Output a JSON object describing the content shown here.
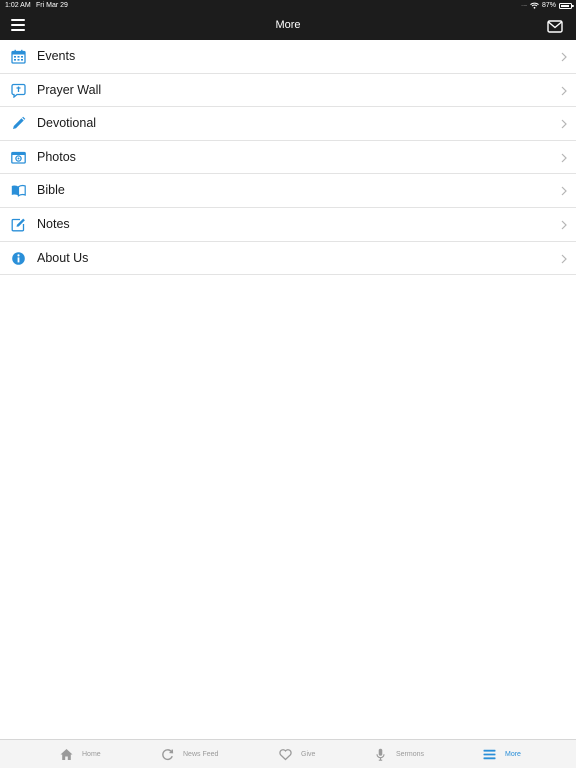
{
  "status_bar": {
    "time": "1:02 AM",
    "date": "Fri Mar 29",
    "signal": ".....",
    "battery_percent_label": "87%",
    "battery_level": 0.87
  },
  "nav": {
    "title": "More",
    "menu_icon": "hamburger-icon",
    "mail_icon": "envelope-icon"
  },
  "colors": {
    "accent": "#2a8fd8",
    "navbar": "#1c1c1c",
    "tab_inactive": "#9a9a9a"
  },
  "menu": {
    "items": [
      {
        "label": "Events",
        "icon": "calendar-icon"
      },
      {
        "label": "Prayer Wall",
        "icon": "prayer-bubble-icon"
      },
      {
        "label": "Devotional",
        "icon": "pencil-icon"
      },
      {
        "label": "Photos",
        "icon": "camera-icon"
      },
      {
        "label": "Bible",
        "icon": "book-icon"
      },
      {
        "label": "Notes",
        "icon": "edit-note-icon"
      },
      {
        "label": "About Us",
        "icon": "info-icon"
      }
    ]
  },
  "tabs": [
    {
      "label": "Home",
      "icon": "home-icon",
      "active": false
    },
    {
      "label": "News Feed",
      "icon": "refresh-icon",
      "active": false
    },
    {
      "label": "Give",
      "icon": "heart-icon",
      "active": false
    },
    {
      "label": "Sermons",
      "icon": "microphone-icon",
      "active": false
    },
    {
      "label": "More",
      "icon": "hamburger-icon",
      "active": true
    }
  ]
}
